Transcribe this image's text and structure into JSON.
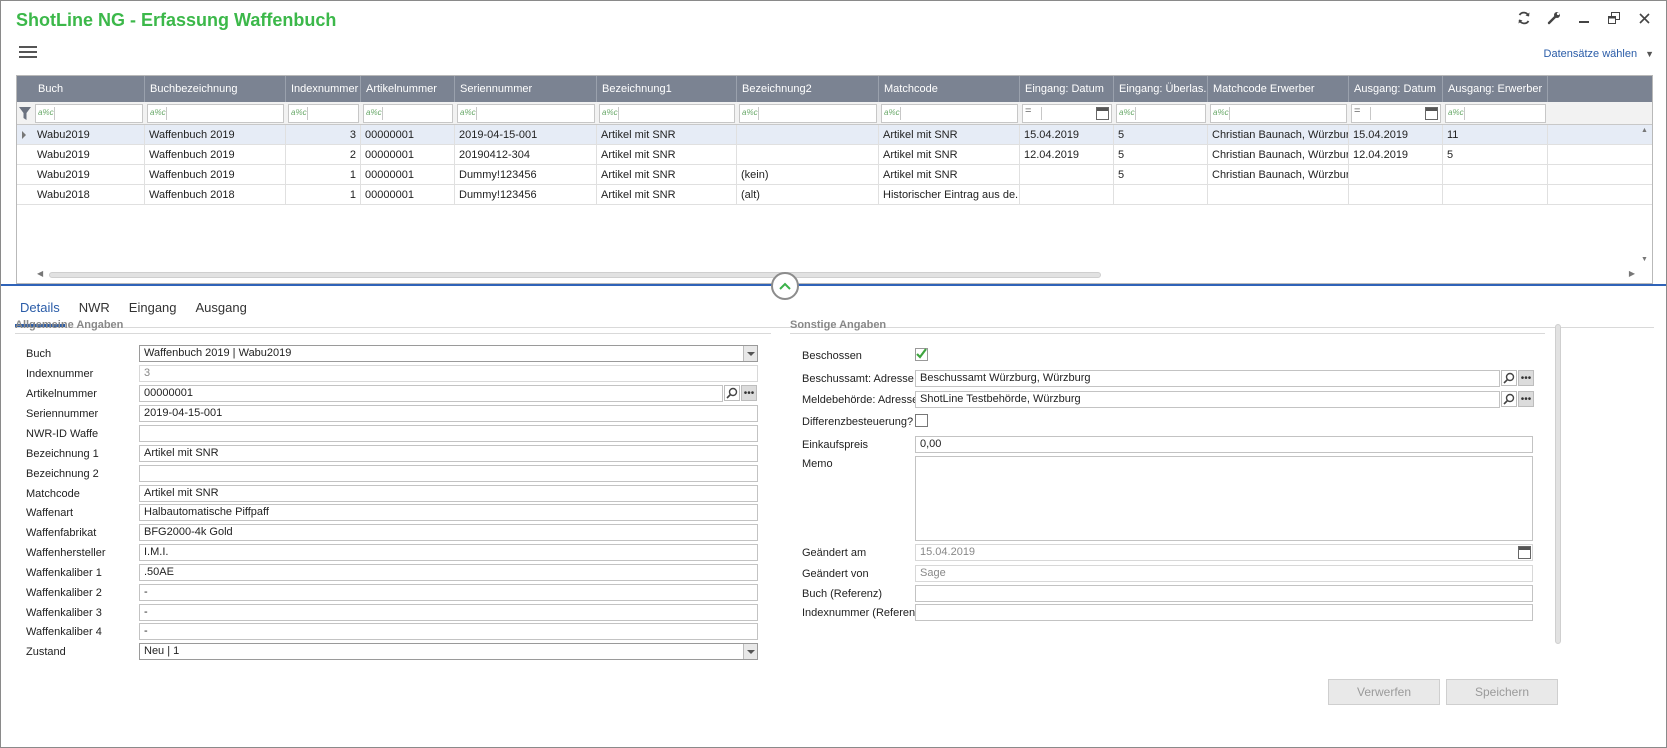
{
  "app": {
    "title": "ShotLine NG - Erfassung Waffenbuch"
  },
  "toolbar": {
    "records_select": "Datensätze wählen"
  },
  "window_icons": [
    "refresh-icon",
    "wrench-icon",
    "minimize-icon",
    "restore-icon",
    "close-icon"
  ],
  "grid": {
    "columns": [
      "Buch",
      "Buchbezeichnung",
      "Indexnummer",
      "Artikelnummer",
      "Seriennummer",
      "Bezeichnung1",
      "Bezeichnung2",
      "Matchcode",
      "Eingang: Datum",
      "Eingang: Überlas...",
      "Matchcode Erwerber",
      "Ausgang: Datum",
      "Ausgang: Erwerber"
    ],
    "filter_ops": [
      "a%c",
      "a%c",
      "a%c",
      "a%c",
      "a%c",
      "a%c",
      "a%c",
      "a%c",
      "=",
      "a%c",
      "a%c",
      "=",
      "a%c"
    ],
    "rows": [
      [
        "Wabu2019",
        "Waffenbuch 2019",
        "3",
        "00000001",
        "2019-04-15-001",
        "Artikel mit SNR",
        "",
        "Artikel mit SNR",
        "15.04.2019",
        "5",
        "Christian Baunach, Würzburg",
        "15.04.2019",
        "11"
      ],
      [
        "Wabu2019",
        "Waffenbuch 2019",
        "2",
        "00000001",
        "20190412-304",
        "Artikel mit SNR",
        "",
        "Artikel mit SNR",
        "12.04.2019",
        "5",
        "Christian Baunach, Würzburg",
        "12.04.2019",
        "5"
      ],
      [
        "Wabu2019",
        "Waffenbuch 2019",
        "1",
        "00000001",
        "Dummy!123456",
        "Artikel mit SNR",
        "(kein)",
        "Artikel mit SNR",
        "",
        "5",
        "Christian Baunach, Würzburg",
        "",
        ""
      ],
      [
        "Wabu2018",
        "Waffenbuch 2018",
        "1",
        "00000001",
        "Dummy!123456",
        "Artikel mit SNR",
        "(alt)",
        "Historischer Eintrag aus de...",
        "",
        "",
        "",
        "",
        ""
      ]
    ]
  },
  "tabs": [
    "Details",
    "NWR",
    "Eingang",
    "Ausgang"
  ],
  "left_section": {
    "title": "Allgemeine Angaben",
    "fields": [
      {
        "label": "Buch",
        "value": "Waffenbuch 2019  |  Wabu2019"
      },
      {
        "label": "Indexnummer",
        "value": "3"
      },
      {
        "label": "Artikelnummer",
        "value": "00000001"
      },
      {
        "label": "Seriennummer",
        "value": "2019-04-15-001"
      },
      {
        "label": "NWR-ID Waffe",
        "value": ""
      },
      {
        "label": "Bezeichnung 1",
        "value": "Artikel mit SNR"
      },
      {
        "label": "Bezeichnung 2",
        "value": ""
      },
      {
        "label": "Matchcode",
        "value": "Artikel mit SNR"
      },
      {
        "label": "Waffenart",
        "value": "Halbautomatische Piffpaff"
      },
      {
        "label": "Waffenfabrikat",
        "value": "BFG2000-4k Gold"
      },
      {
        "label": "Waffenhersteller",
        "value": "I.M.I."
      },
      {
        "label": "Waffenkaliber 1",
        "value": ".50AE"
      },
      {
        "label": "Waffenkaliber 2",
        "value": "-"
      },
      {
        "label": "Waffenkaliber 3",
        "value": "-"
      },
      {
        "label": "Waffenkaliber 4",
        "value": "-"
      },
      {
        "label": "Zustand",
        "value": "Neu  |  1"
      }
    ]
  },
  "right_section": {
    "title": "Sonstige Angaben",
    "beschossen": {
      "label": "Beschossen",
      "checked": true
    },
    "beschussamt": {
      "label": "Beschussamt: Adresse",
      "value": "Beschussamt Würzburg, Würzburg"
    },
    "meldebehoerde": {
      "label": "Meldebehörde: Adresse",
      "value": "ShotLine Testbehörde, Würzburg"
    },
    "differenz": {
      "label": "Differenzbesteuerung?",
      "checked": false
    },
    "einkaufspreis": {
      "label": "Einkaufspreis",
      "value": "0,00"
    },
    "memo": {
      "label": "Memo",
      "value": ""
    },
    "geaendert_am": {
      "label": "Geändert am",
      "value": "15.04.2019"
    },
    "geaendert_von": {
      "label": "Geändert von",
      "value": "Sage"
    },
    "buch_ref": {
      "label": "Buch (Referenz)",
      "value": ""
    },
    "index_ref": {
      "label": "Indexnummer (Referenz)",
      "value": ""
    }
  },
  "footer": {
    "discard": "Verwerfen",
    "save": "Speichern"
  }
}
